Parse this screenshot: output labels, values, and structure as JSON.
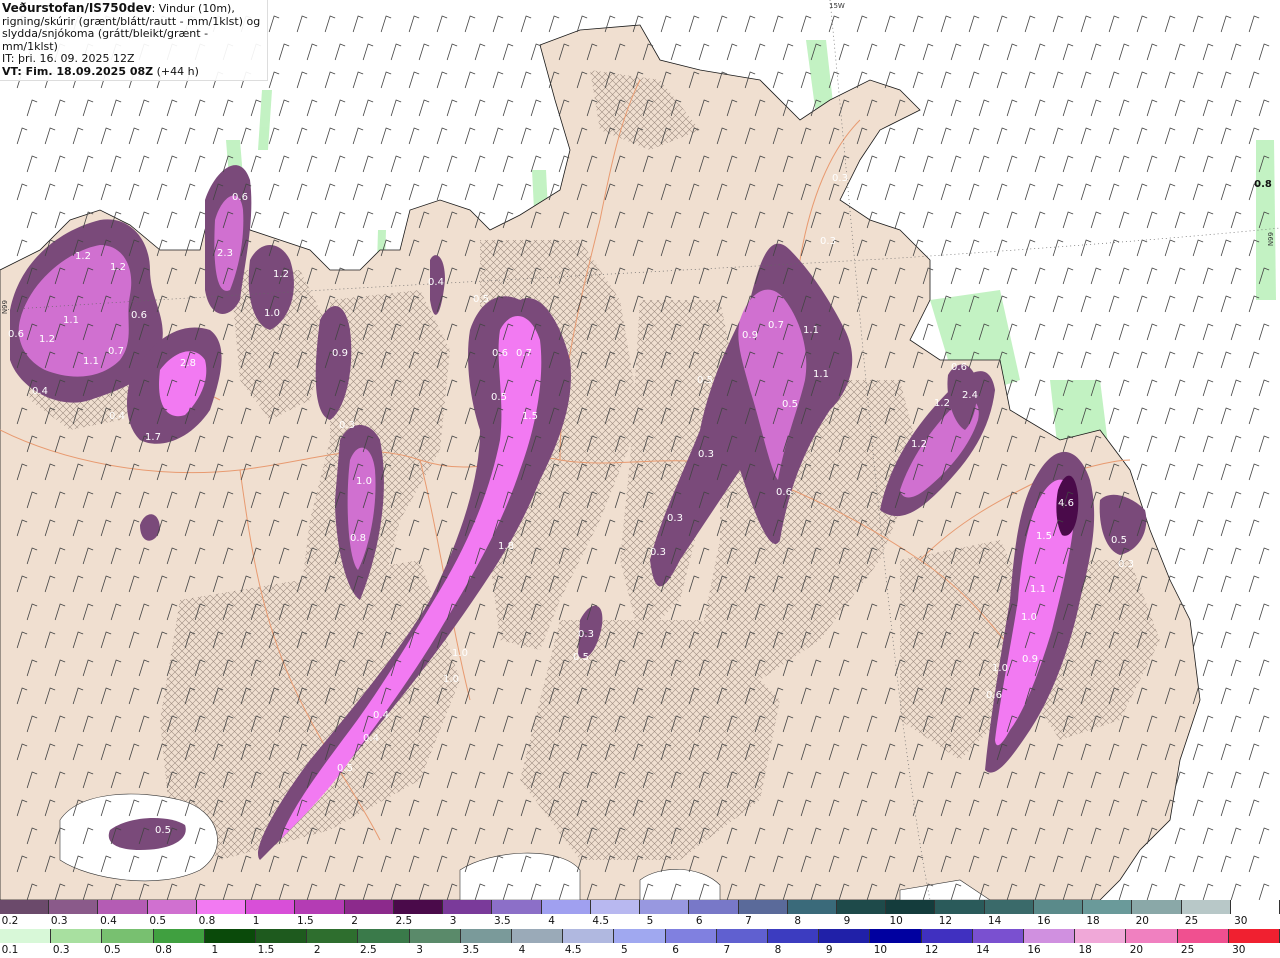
{
  "header": {
    "title_bold": "Veðurstofan/IS750dev",
    "title_rest": ": Vindur (10m),",
    "line2": "rigning/skúrir (grænt/blátt/rautt - mm/1klst) og",
    "line3": "slydda/snjókoma (grátt/bleikt/grænt - mm/1klst)",
    "init": "IT: þri. 16. 09. 2025 12Z",
    "valid_bold": "VT: Fim. 18.09.2025 08Z",
    "valid_rest": " (+44 h)"
  },
  "coords": {
    "lon_top": "15W",
    "lat_right": "66N",
    "lat_left": "66N"
  },
  "map_labels": [
    {
      "text": "1.2"
    },
    {
      "text": "1.2"
    },
    {
      "text": "0.6"
    },
    {
      "text": "1.2"
    },
    {
      "text": "1.1"
    },
    {
      "text": "0.6"
    },
    {
      "text": "0.7"
    },
    {
      "text": "1.1"
    },
    {
      "text": "0.4"
    },
    {
      "text": "0.4"
    },
    {
      "text": "2.8"
    },
    {
      "text": "1.7"
    },
    {
      "text": "2.3"
    },
    {
      "text": "0.6"
    },
    {
      "text": "1.2"
    },
    {
      "text": "1.0"
    },
    {
      "text": "0.9"
    },
    {
      "text": "0.3"
    },
    {
      "text": "1.0"
    },
    {
      "text": "0.8"
    },
    {
      "text": "0.4"
    },
    {
      "text": "0.5"
    },
    {
      "text": "0.6"
    },
    {
      "text": "0.7"
    },
    {
      "text": "0.5"
    },
    {
      "text": "1.5"
    },
    {
      "text": "1.8"
    },
    {
      "text": "1.0"
    },
    {
      "text": "1.0"
    },
    {
      "text": "0.4"
    },
    {
      "text": "0.4"
    },
    {
      "text": "0.5"
    },
    {
      "text": "0.5"
    },
    {
      "text": "0.3"
    },
    {
      "text": "0.3"
    },
    {
      "text": "0.3"
    },
    {
      "text": "0.3"
    },
    {
      "text": "0.3"
    },
    {
      "text": "0.9"
    },
    {
      "text": "0.7"
    },
    {
      "text": "1.1"
    },
    {
      "text": "1.1"
    },
    {
      "text": "0.5"
    },
    {
      "text": "0.5"
    },
    {
      "text": "0.6"
    },
    {
      "text": "0.3"
    },
    {
      "text": "0.6"
    },
    {
      "text": "1.2"
    },
    {
      "text": "2.4"
    },
    {
      "text": "1.2"
    },
    {
      "text": "4.6"
    },
    {
      "text": "1.5"
    },
    {
      "text": "1.1"
    },
    {
      "text": "1.0"
    },
    {
      "text": "1.0"
    },
    {
      "text": "0.9"
    },
    {
      "text": "0.6"
    },
    {
      "text": "0.5"
    },
    {
      "text": "0.3"
    },
    {
      "text": "0.8"
    },
    {
      "text": "0.5"
    }
  ],
  "legend_snow": {
    "labels": [
      "0.2",
      "0.3",
      "0.4",
      "0.5",
      "0.8",
      "1",
      "1.5",
      "2",
      "2.5",
      "3",
      "3.5",
      "4",
      "4.5",
      "5",
      "6",
      "7",
      "8",
      "9",
      "10",
      "12",
      "14",
      "16",
      "18",
      "20",
      "25",
      "30"
    ],
    "colors": [
      "#6b4a6b",
      "#8a5a8a",
      "#b45cb4",
      "#d070d0",
      "#f27af2",
      "#d84fd8",
      "#b43cb4",
      "#8c2a8c",
      "#4a0a4a",
      "#7a3a9a",
      "#8c6fc8",
      "#a0a0f0",
      "#b8b8f0",
      "#9898e0",
      "#7878c8",
      "#5a6a9a",
      "#3a6a7a",
      "#1e4a4a",
      "#143c3c",
      "#2a5a5a",
      "#3a6a6a",
      "#5a8a8a",
      "#6a9a9a",
      "#8aa8a8",
      "#b8c8c8",
      "#ffffff"
    ]
  },
  "legend_rain": {
    "labels": [
      "0.1",
      "0.3",
      "0.5",
      "0.8",
      "1",
      "1.5",
      "2",
      "2.5",
      "3",
      "3.5",
      "4",
      "4.5",
      "5",
      "6",
      "7",
      "8",
      "9",
      "10",
      "12",
      "14",
      "16",
      "18",
      "20",
      "25",
      "30"
    ],
    "colors": [
      "#d8f8d8",
      "#a8e0a0",
      "#78c070",
      "#40a040",
      "#0a4a0a",
      "#1e5a1e",
      "#2e6e2e",
      "#3a7a4a",
      "#5a8a6a",
      "#7a9a9a",
      "#9aaab8",
      "#b0b8e0",
      "#a0a8f0",
      "#8080e0",
      "#6060d0",
      "#3c3cc0",
      "#2020a8",
      "#0000a0",
      "#4030c0",
      "#7a50d0",
      "#d090e0",
      "#f0a8d8",
      "#f080c0",
      "#f05090",
      "#f02030"
    ]
  }
}
